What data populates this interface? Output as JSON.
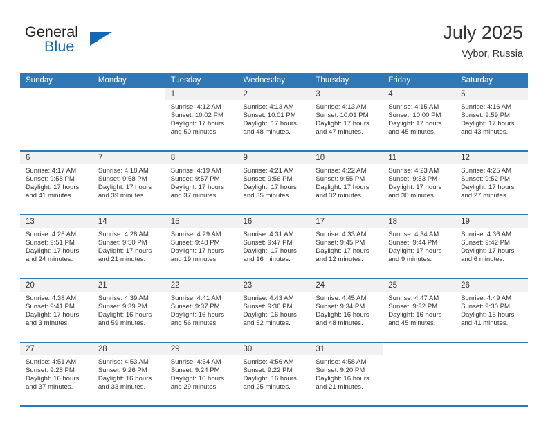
{
  "brand": {
    "name_part1": "General",
    "name_part2": "Blue",
    "logo_icon": "triangle-logo-icon",
    "accent_color": "#1268b3"
  },
  "header": {
    "title": "July 2025",
    "location": "Vybor, Russia"
  },
  "theme": {
    "header_row_color": "#2f77b5",
    "day_band_color": "#f1f1f1",
    "text_color": "#333333"
  },
  "calendar": {
    "weekday_headers": [
      "Sunday",
      "Monday",
      "Tuesday",
      "Wednesday",
      "Thursday",
      "Friday",
      "Saturday"
    ],
    "weeks": [
      [
        {
          "day": "",
          "sunrise": "",
          "sunset": "",
          "daylight": "",
          "blank": true
        },
        {
          "day": "",
          "sunrise": "",
          "sunset": "",
          "daylight": "",
          "blank": true
        },
        {
          "day": "1",
          "sunrise": "Sunrise: 4:12 AM",
          "sunset": "Sunset: 10:02 PM",
          "daylight": "Daylight: 17 hours and 50 minutes."
        },
        {
          "day": "2",
          "sunrise": "Sunrise: 4:13 AM",
          "sunset": "Sunset: 10:01 PM",
          "daylight": "Daylight: 17 hours and 48 minutes."
        },
        {
          "day": "3",
          "sunrise": "Sunrise: 4:13 AM",
          "sunset": "Sunset: 10:01 PM",
          "daylight": "Daylight: 17 hours and 47 minutes."
        },
        {
          "day": "4",
          "sunrise": "Sunrise: 4:15 AM",
          "sunset": "Sunset: 10:00 PM",
          "daylight": "Daylight: 17 hours and 45 minutes."
        },
        {
          "day": "5",
          "sunrise": "Sunrise: 4:16 AM",
          "sunset": "Sunset: 9:59 PM",
          "daylight": "Daylight: 17 hours and 43 minutes."
        }
      ],
      [
        {
          "day": "6",
          "sunrise": "Sunrise: 4:17 AM",
          "sunset": "Sunset: 9:58 PM",
          "daylight": "Daylight: 17 hours and 41 minutes."
        },
        {
          "day": "7",
          "sunrise": "Sunrise: 4:18 AM",
          "sunset": "Sunset: 9:58 PM",
          "daylight": "Daylight: 17 hours and 39 minutes."
        },
        {
          "day": "8",
          "sunrise": "Sunrise: 4:19 AM",
          "sunset": "Sunset: 9:57 PM",
          "daylight": "Daylight: 17 hours and 37 minutes."
        },
        {
          "day": "9",
          "sunrise": "Sunrise: 4:21 AM",
          "sunset": "Sunset: 9:56 PM",
          "daylight": "Daylight: 17 hours and 35 minutes."
        },
        {
          "day": "10",
          "sunrise": "Sunrise: 4:22 AM",
          "sunset": "Sunset: 9:55 PM",
          "daylight": "Daylight: 17 hours and 32 minutes."
        },
        {
          "day": "11",
          "sunrise": "Sunrise: 4:23 AM",
          "sunset": "Sunset: 9:53 PM",
          "daylight": "Daylight: 17 hours and 30 minutes."
        },
        {
          "day": "12",
          "sunrise": "Sunrise: 4:25 AM",
          "sunset": "Sunset: 9:52 PM",
          "daylight": "Daylight: 17 hours and 27 minutes."
        }
      ],
      [
        {
          "day": "13",
          "sunrise": "Sunrise: 4:26 AM",
          "sunset": "Sunset: 9:51 PM",
          "daylight": "Daylight: 17 hours and 24 minutes."
        },
        {
          "day": "14",
          "sunrise": "Sunrise: 4:28 AM",
          "sunset": "Sunset: 9:50 PM",
          "daylight": "Daylight: 17 hours and 21 minutes."
        },
        {
          "day": "15",
          "sunrise": "Sunrise: 4:29 AM",
          "sunset": "Sunset: 9:48 PM",
          "daylight": "Daylight: 17 hours and 19 minutes."
        },
        {
          "day": "16",
          "sunrise": "Sunrise: 4:31 AM",
          "sunset": "Sunset: 9:47 PM",
          "daylight": "Daylight: 17 hours and 16 minutes."
        },
        {
          "day": "17",
          "sunrise": "Sunrise: 4:33 AM",
          "sunset": "Sunset: 9:45 PM",
          "daylight": "Daylight: 17 hours and 12 minutes."
        },
        {
          "day": "18",
          "sunrise": "Sunrise: 4:34 AM",
          "sunset": "Sunset: 9:44 PM",
          "daylight": "Daylight: 17 hours and 9 minutes."
        },
        {
          "day": "19",
          "sunrise": "Sunrise: 4:36 AM",
          "sunset": "Sunset: 9:42 PM",
          "daylight": "Daylight: 17 hours and 6 minutes."
        }
      ],
      [
        {
          "day": "20",
          "sunrise": "Sunrise: 4:38 AM",
          "sunset": "Sunset: 9:41 PM",
          "daylight": "Daylight: 17 hours and 3 minutes."
        },
        {
          "day": "21",
          "sunrise": "Sunrise: 4:39 AM",
          "sunset": "Sunset: 9:39 PM",
          "daylight": "Daylight: 16 hours and 59 minutes."
        },
        {
          "day": "22",
          "sunrise": "Sunrise: 4:41 AM",
          "sunset": "Sunset: 9:37 PM",
          "daylight": "Daylight: 16 hours and 56 minutes."
        },
        {
          "day": "23",
          "sunrise": "Sunrise: 4:43 AM",
          "sunset": "Sunset: 9:36 PM",
          "daylight": "Daylight: 16 hours and 52 minutes."
        },
        {
          "day": "24",
          "sunrise": "Sunrise: 4:45 AM",
          "sunset": "Sunset: 9:34 PM",
          "daylight": "Daylight: 16 hours and 48 minutes."
        },
        {
          "day": "25",
          "sunrise": "Sunrise: 4:47 AM",
          "sunset": "Sunset: 9:32 PM",
          "daylight": "Daylight: 16 hours and 45 minutes."
        },
        {
          "day": "26",
          "sunrise": "Sunrise: 4:49 AM",
          "sunset": "Sunset: 9:30 PM",
          "daylight": "Daylight: 16 hours and 41 minutes."
        }
      ],
      [
        {
          "day": "27",
          "sunrise": "Sunrise: 4:51 AM",
          "sunset": "Sunset: 9:28 PM",
          "daylight": "Daylight: 16 hours and 37 minutes."
        },
        {
          "day": "28",
          "sunrise": "Sunrise: 4:53 AM",
          "sunset": "Sunset: 9:26 PM",
          "daylight": "Daylight: 16 hours and 33 minutes."
        },
        {
          "day": "29",
          "sunrise": "Sunrise: 4:54 AM",
          "sunset": "Sunset: 9:24 PM",
          "daylight": "Daylight: 16 hours and 29 minutes."
        },
        {
          "day": "30",
          "sunrise": "Sunrise: 4:56 AM",
          "sunset": "Sunset: 9:22 PM",
          "daylight": "Daylight: 16 hours and 25 minutes."
        },
        {
          "day": "31",
          "sunrise": "Sunrise: 4:58 AM",
          "sunset": "Sunset: 9:20 PM",
          "daylight": "Daylight: 16 hours and 21 minutes."
        },
        {
          "day": "",
          "sunrise": "",
          "sunset": "",
          "daylight": "",
          "blank": true
        },
        {
          "day": "",
          "sunrise": "",
          "sunset": "",
          "daylight": "",
          "blank": true
        }
      ]
    ]
  }
}
